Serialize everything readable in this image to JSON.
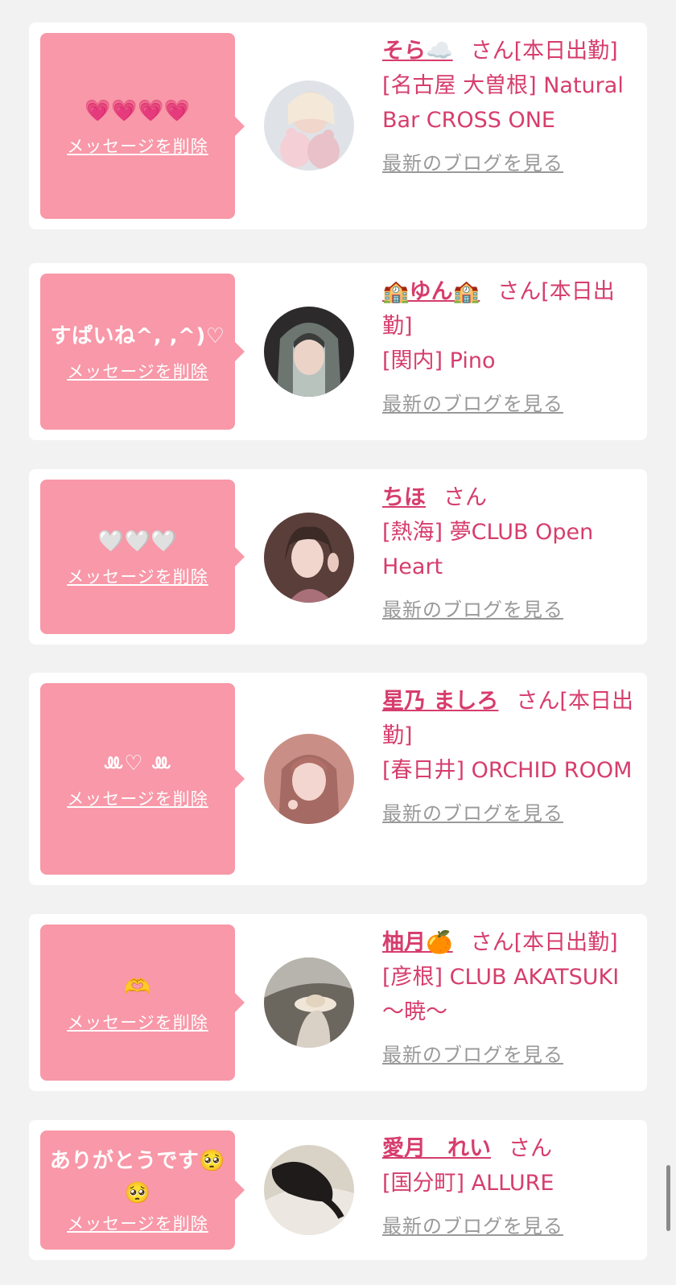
{
  "cards": [
    {
      "message": "💗💗💗💗",
      "delete_label": "メッセージを削除",
      "name": "そら☁️",
      "suffix": "さん[本日出勤]",
      "store": "[名古屋 大曽根] Natural Bar CROSS ONE",
      "blog_label": "最新のブログを見る"
    },
    {
      "message": "すぱいね^, ,^)♡",
      "delete_label": "メッセージを削除",
      "name": "🏫ゆん🏫",
      "suffix": "さん[本日出勤]",
      "store": "[関内] Pino",
      "blog_label": "最新のブログを見る"
    },
    {
      "message": "🤍🤍🤍",
      "delete_label": "メッセージを削除",
      "name": "ちほ",
      "suffix": "さん",
      "store": "[熱海] 夢CLUB Open Heart",
      "blog_label": "最新のブログを見る"
    },
    {
      "message": "ꔛ♡ ꔛ",
      "delete_label": "メッセージを削除",
      "name": "星乃 ましろ",
      "suffix": "さん[本日出勤]",
      "store": "[春日井] ORCHID ROOM",
      "blog_label": "最新のブログを見る"
    },
    {
      "message": "🫶",
      "delete_label": "メッセージを削除",
      "name": "柚月🍊",
      "suffix": "さん[本日出勤]",
      "store": "[彦根] CLUB AKATSUKI 〜暁〜",
      "blog_label": "最新のブログを見る"
    },
    {
      "message": "ありがとうです🥺🥺",
      "delete_label": "メッセージを削除",
      "name": "愛月　れい",
      "suffix": "さん",
      "store": "[国分町] ALLURE",
      "blog_label": "最新のブログを見る"
    }
  ],
  "colors": {
    "accent": "#d63d6d",
    "bubble": "#f898a8",
    "link_gray": "#999999",
    "background": "#f2f2f2"
  }
}
